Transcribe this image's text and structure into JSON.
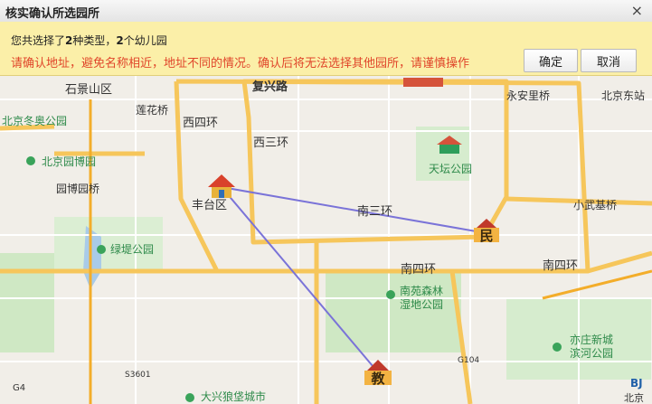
{
  "window": {
    "title": "核实确认所选园所",
    "close_symbol": "×"
  },
  "notice": {
    "prefix": "您共选择了",
    "type_count": "2",
    "mid": "种类型，",
    "kindergarten_count": "2",
    "suffix": "个幼儿园",
    "warning": "请确认地址，避免名称相近，地址不同的情况。确认后将无法选择其他园所，请谨慎操作"
  },
  "buttons": {
    "confirm": "确定",
    "cancel": "取消"
  },
  "map": {
    "labels": {
      "shijingshan": "石景山区",
      "fuxinglu": "复兴路",
      "yonganli": "永安里桥",
      "beijingdongzhan": "北京东站",
      "beijingdongao": "北京冬奥公园",
      "lianhuaqiao": "莲花桥",
      "xisihuan": "西四环",
      "xisanhuan": "西三环",
      "tiantan": "天坛公园",
      "beijingyuanbo": "北京园博园",
      "yuanboyuanqiao": "园博园桥",
      "fengtai": "丰台区",
      "nansanhuan": "南三环",
      "xiaowuji": "小武基桥",
      "lvdi": "绿堤公园",
      "nansihuan_mid": "南四环",
      "nansihuan_right": "南四环",
      "nanyuan1": "南苑森林",
      "nanyuan2": "湿地公园",
      "yizhuang1": "亦庄新城",
      "yizhuang2": "滨河公园",
      "daxing": "大兴狼垡城市",
      "s3601": "S3601",
      "g104": "G104",
      "g4": "G4",
      "bj_logo": "BJ",
      "beijing_part": "北京"
    },
    "markers": {
      "min": "民",
      "jiao": "教"
    }
  }
}
